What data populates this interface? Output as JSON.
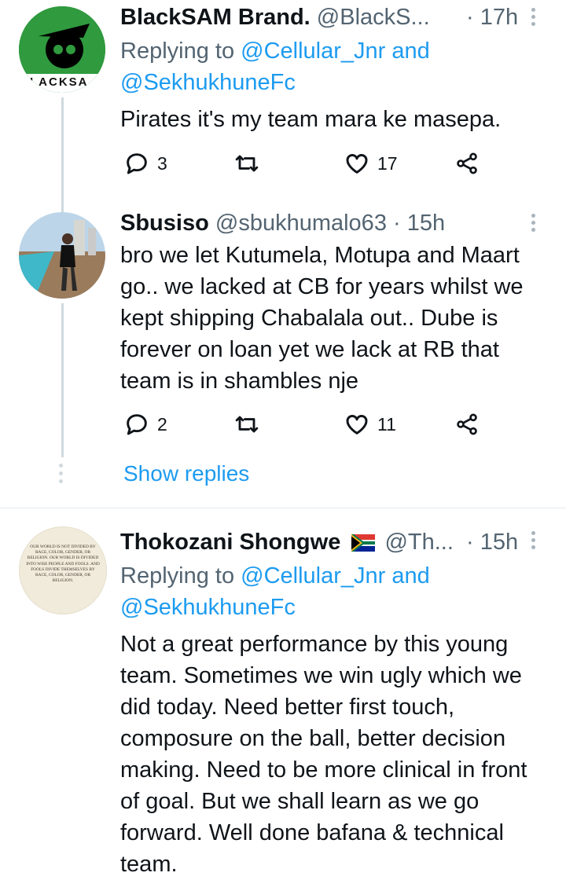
{
  "tweets": [
    {
      "name": "BlackSAM Brand.",
      "handle": "@BlackS...",
      "time": "· 17h",
      "replying_prefix": "Replying to",
      "replying_user1": "@Cellular_Jnr",
      "replying_and": "and",
      "replying_user2": "@SekhukhuneFc",
      "text": "Pirates it's my team mara ke masepa.",
      "replies": "3",
      "likes": "17",
      "avatar_text": "LACKSA"
    },
    {
      "name": "Sbusiso",
      "handle": "@sbukhumalo63",
      "time": "· 15h",
      "text": "bro we let Kutumela, Motupa and Maart go.. we lacked at CB for years whilst we kept shipping Chabalala out.. Dube is forever on loan yet we lack at RB that team is in shambles nje",
      "replies": "2",
      "likes": "11",
      "show_replies": "Show replies"
    },
    {
      "name": "Thokozani Shongwe",
      "handle": "@Th...",
      "time": "· 15h",
      "replying_prefix": "Replying to",
      "replying_user1": "@Cellular_Jnr",
      "replying_and": "and",
      "replying_user2": "@SekhukhuneFc",
      "text": "Not a great performance by this young team. Sometimes we win ugly which we did today. Need better first touch, composure on the ball, better decision making. Need to be more clinical in front of goal. But we shall learn as we go forward. Well done bafana & technical team.",
      "avatar_text": "Our world is not divided by race, color, gender, or religion. Our world is divided into wise people and fools. And fools divide themselves by race, color, gender, or religion."
    }
  ],
  "colors": {
    "link": "#1d9bf0",
    "muted": "#536471",
    "thread": "#cfd9de"
  }
}
